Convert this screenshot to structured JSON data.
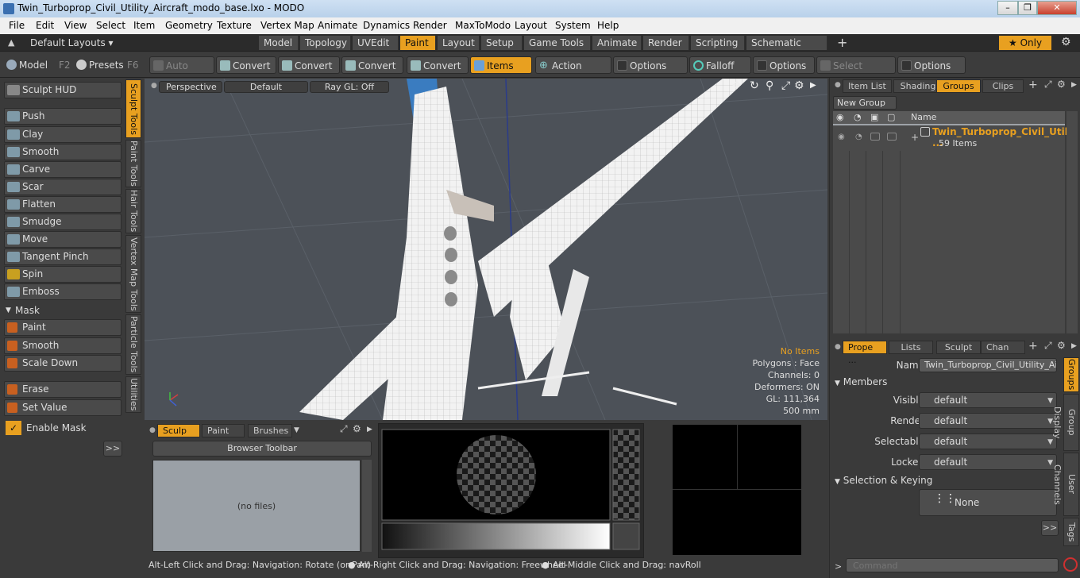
{
  "window": {
    "title": "Twin_Turboprop_Civil_Utility_Aircraft_modo_base.lxo - MODO"
  },
  "menu": [
    "File",
    "Edit",
    "View",
    "Select",
    "Item",
    "Geometry",
    "Texture",
    "Vertex Map",
    "Animate",
    "Dynamics",
    "Render",
    "MaxToModo",
    "Layout",
    "System",
    "Help"
  ],
  "layoutbar": {
    "layouts_label": "Default Layouts",
    "tabs": [
      "Model",
      "Topology",
      "UVEdit",
      "Paint",
      "Layout",
      "Setup",
      "Game Tools",
      "Animate",
      "Render",
      "Scripting",
      "Schematic Fusion"
    ],
    "active_tab": "Paint",
    "only_label": "Only"
  },
  "toolbar": {
    "model_label": "Model",
    "model_key": "F2",
    "presets_label": "Presets",
    "presets_key": "F6",
    "auto_select": "Auto Select",
    "convert1": "Convert",
    "convert2": "Convert",
    "convert3": "Convert",
    "convert4": "Convert",
    "items": "Items",
    "action_center": "Action Center",
    "options1": "Options",
    "falloff": "Falloff",
    "options2": "Options",
    "select_through": "Select Through",
    "options3": "Options"
  },
  "lefttools": {
    "sculpt_hud": "Sculpt HUD",
    "tools": [
      "Push",
      "Clay",
      "Smooth",
      "Carve",
      "Scar",
      "Flatten",
      "Smudge",
      "Move",
      "Tangent Pinch",
      "Spin",
      "Emboss"
    ],
    "mask_header": "Mask",
    "mask_tools": [
      "Paint",
      "Smooth",
      "Scale Down"
    ],
    "erase": "Erase",
    "set_value": "Set Value",
    "enable_mask": "Enable Mask",
    "more": ">>"
  },
  "vtabs": [
    "Sculpt Tools",
    "Paint Tools",
    "Hair Tools",
    "Vertex Map Tools",
    "Particle Tools",
    "Utilities"
  ],
  "viewport": {
    "perspective": "Perspective",
    "default": "Default",
    "raygl": "Ray GL: Off",
    "stats": {
      "no_items": "No Items",
      "polygons": "Polygons : Face",
      "channels": "Channels: 0",
      "deformers": "Deformers: ON",
      "gl": "GL: 111,364",
      "size": "500 mm"
    }
  },
  "bottompanel": {
    "tabs": [
      "Sculp ...",
      "Paint ...",
      "Brushes"
    ],
    "browser_toolbar": "Browser Toolbar",
    "no_files": "(no files)"
  },
  "statusbar": {
    "hint1": "Alt-Left Click and Drag: Navigation: Rotate (or Pan)",
    "hint2": "Alt-Right Click and Drag: Navigation: Freewheel",
    "hint3": "Alt-Middle Click and Drag: navRoll"
  },
  "rightpanel": {
    "tabs": [
      "Item List",
      "Shading",
      "Groups",
      "Clips"
    ],
    "active_tab": "Groups",
    "new_group": "New Group",
    "name_col": "Name",
    "group_name": "Twin_Turboprop_Civil_Utili ...",
    "group_count": "59 Items",
    "prop_tabs": [
      "Prope ...",
      "Lists",
      "Sculpt",
      "Chan ..."
    ],
    "name_label": "Name",
    "name_value": "Twin_Turboprop_Civil_Utility_Aircra",
    "members_header": "Members",
    "visible_label": "Visible",
    "render_label": "Render",
    "selectable_label": "Selectable",
    "locked_label": "Locked",
    "default_value": "default",
    "selection_header": "Selection & Keying",
    "none_label": "None",
    "more": ">>",
    "side_tabs": [
      "Groups",
      "Group Display",
      "User Channels",
      "Tags"
    ],
    "command_placeholder": "Command"
  }
}
